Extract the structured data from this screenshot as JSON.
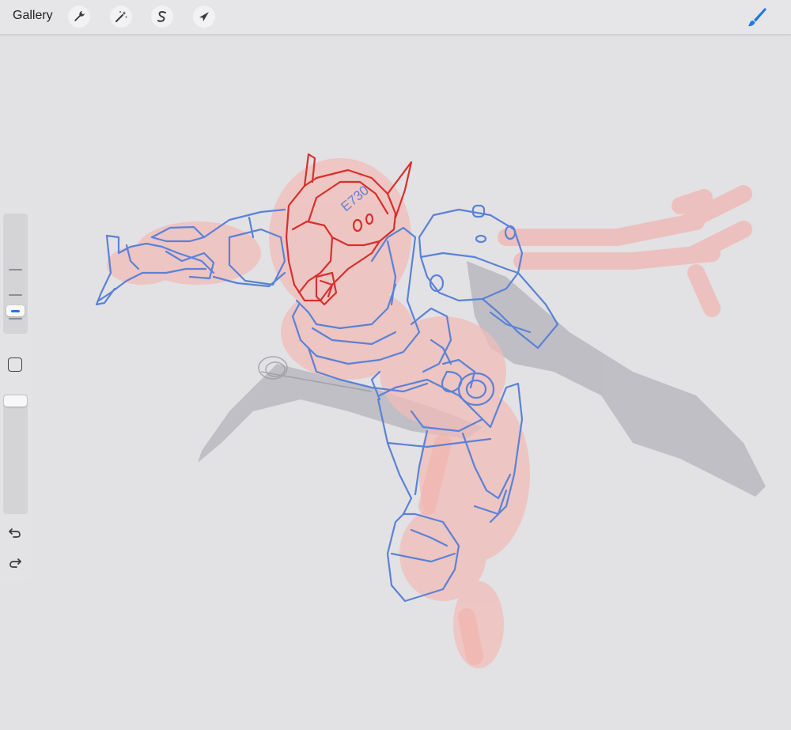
{
  "topbar": {
    "gallery_label": "Gallery",
    "tools": [
      {
        "name": "actions",
        "icon": "wrench-icon"
      },
      {
        "name": "adjustments",
        "icon": "magic-wand-icon"
      },
      {
        "name": "selection",
        "icon": "selection-s-icon"
      },
      {
        "name": "transform",
        "icon": "arrow-cursor-icon"
      }
    ],
    "active_tool": {
      "name": "brush",
      "icon": "brush-icon",
      "color": "#1f7ae0"
    }
  },
  "sidebar": {
    "brush_size_icon": "size-slider",
    "modify_icon": "square-icon",
    "undo_icon": "undo-icon",
    "redo_icon": "redo-icon"
  },
  "canvas": {
    "background": "#e2e1e4",
    "sketch_label": "E730",
    "colors": {
      "blue_lines": "#5b82d6",
      "red_lines": "#d9302c",
      "pink_wash": "#f0b7b4",
      "shadow": "#b8b8bf"
    }
  }
}
